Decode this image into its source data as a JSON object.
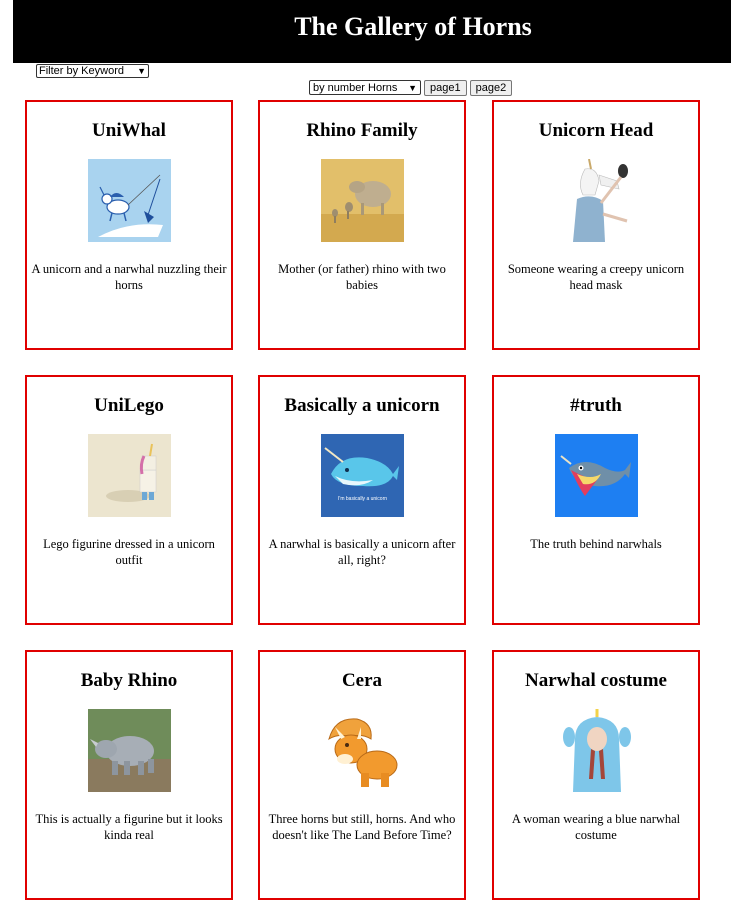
{
  "header": {
    "title": "The Gallery of Horns"
  },
  "filter": {
    "selected": "Filter by Keyword"
  },
  "sort": {
    "selected": "by number Horns"
  },
  "pagination": {
    "page1": "page1",
    "page2": "page2"
  },
  "colors": {
    "card_border": "#e00000",
    "header_bg": "#000000"
  },
  "cards": [
    {
      "title": "UniWhal",
      "description": "A unicorn and a narwhal nuzzling their horns",
      "image": "unicorn-narwhal-illustration"
    },
    {
      "title": "Rhino Family",
      "description": "Mother (or father) rhino with two babies",
      "image": "rhino-family-photo"
    },
    {
      "title": "Unicorn Head",
      "description": "Someone wearing a creepy unicorn head mask",
      "image": "unicorn-mask-photo"
    },
    {
      "title": "UniLego",
      "description": "Lego figurine dressed in a unicorn outfit",
      "image": "lego-unicorn-photo"
    },
    {
      "title": "Basically a unicorn",
      "description": "A narwhal is basically a unicorn after all, right?",
      "image": "cartoon-narwhal",
      "caption": "I'm basically a unicorn"
    },
    {
      "title": "#truth",
      "description": "The truth behind narwhals",
      "image": "narwhal-truth-illustration"
    },
    {
      "title": "Baby Rhino",
      "description": "This is actually a figurine but it looks kinda real",
      "image": "rhino-figurine-photo"
    },
    {
      "title": "Cera",
      "description": "Three horns but still, horns. And who doesn't like The Land Before Time?",
      "image": "triceratops-cartoon"
    },
    {
      "title": "Narwhal costume",
      "description": "A woman wearing a blue narwhal costume",
      "image": "narwhal-costume-photo"
    }
  ]
}
